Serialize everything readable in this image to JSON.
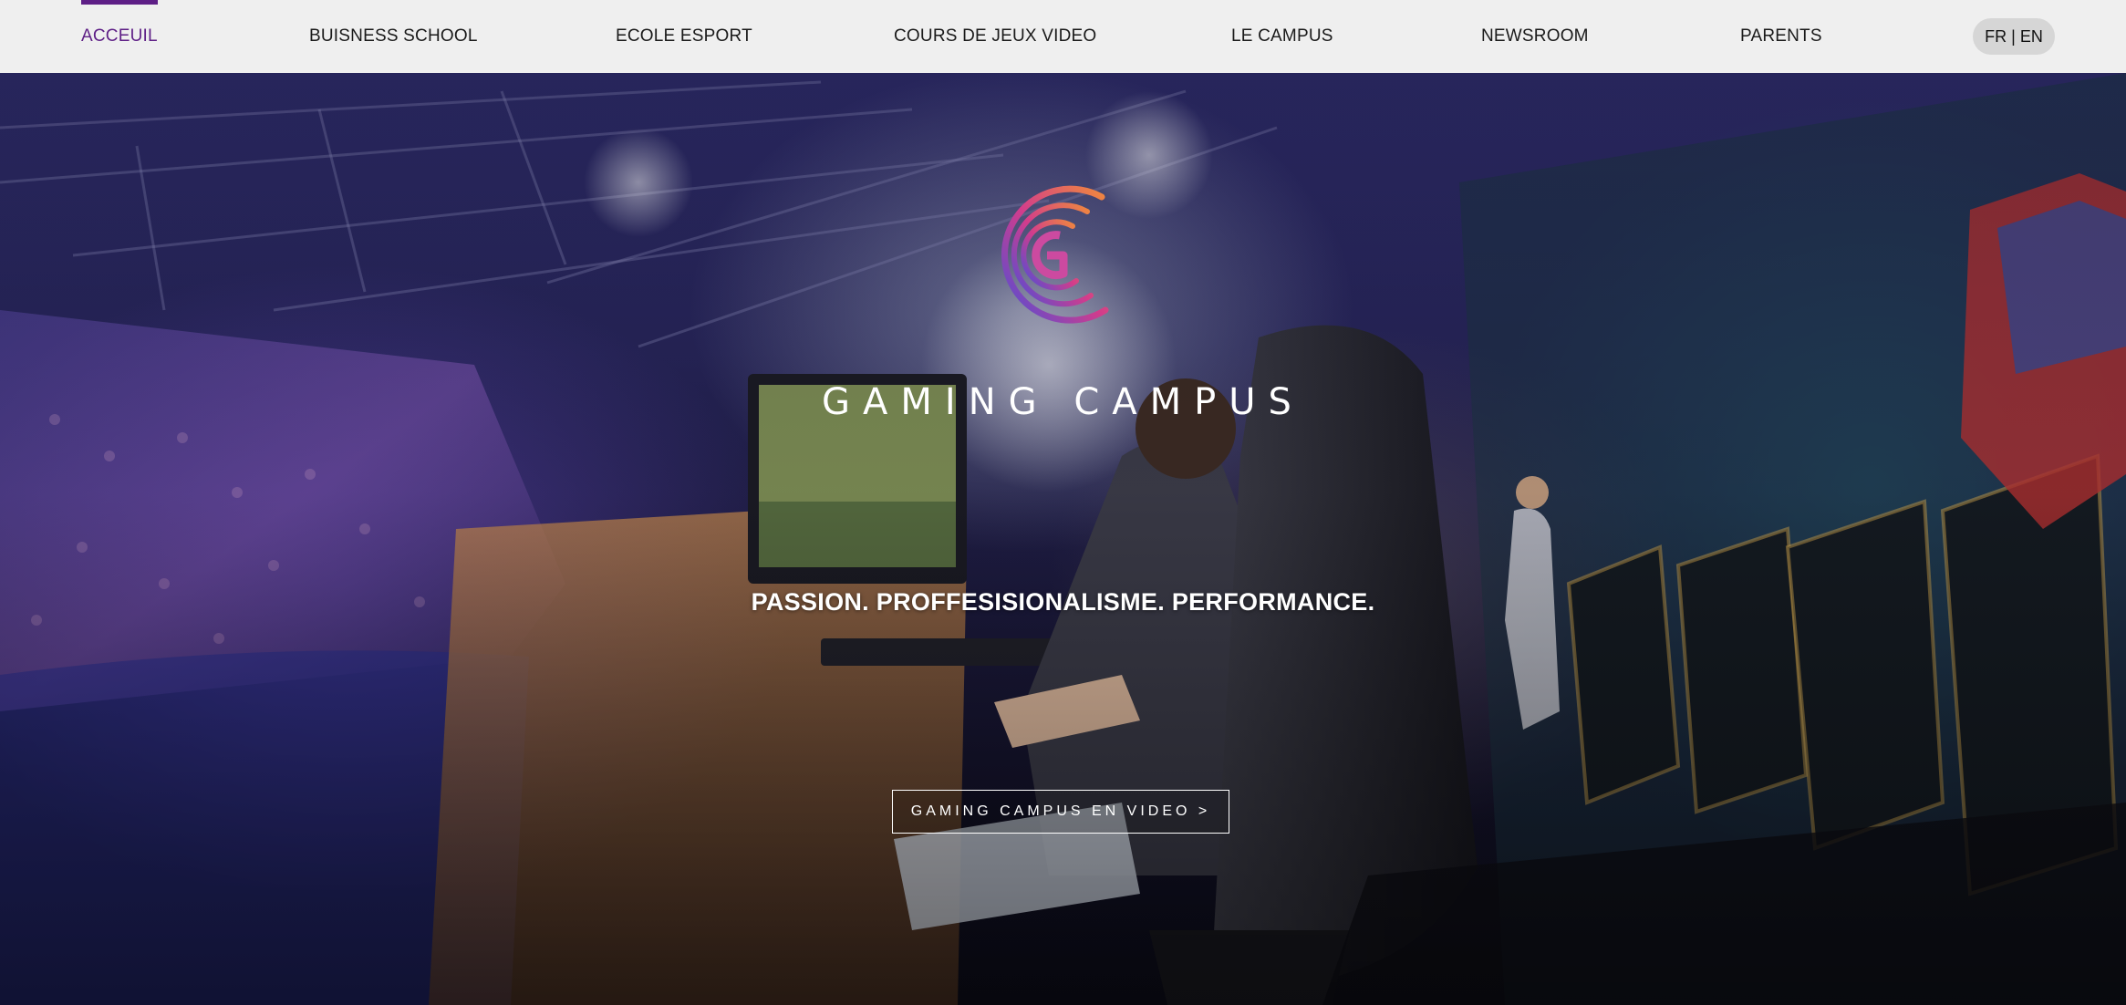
{
  "nav": {
    "items": [
      {
        "label": "ACCEUIL",
        "active": true
      },
      {
        "label": "BUISNESS SCHOOL",
        "active": false
      },
      {
        "label": "ECOLE ESPORT",
        "active": false
      },
      {
        "label": "COURS DE JEUX VIDEO",
        "active": false
      },
      {
        "label": "LE CAMPUS",
        "active": false
      },
      {
        "label": "NEWSROOM",
        "active": false
      },
      {
        "label": "PARENTS",
        "active": false
      }
    ],
    "lang": "FR | EN"
  },
  "hero": {
    "brand": "GAMING CAMPUS",
    "logo_icon": "gaming-campus-logo",
    "tagline": "PASSION. PROFFESISIONALISME. PERFORMANCE.",
    "cta": "GAMING CAMPUS EN VIDEO >"
  },
  "colors": {
    "accent": "#5e1f86",
    "nav_bg": "#efefef",
    "logo_orange": "#f08a3c",
    "logo_pink": "#d23c8c",
    "logo_blue": "#4a4fd8"
  }
}
